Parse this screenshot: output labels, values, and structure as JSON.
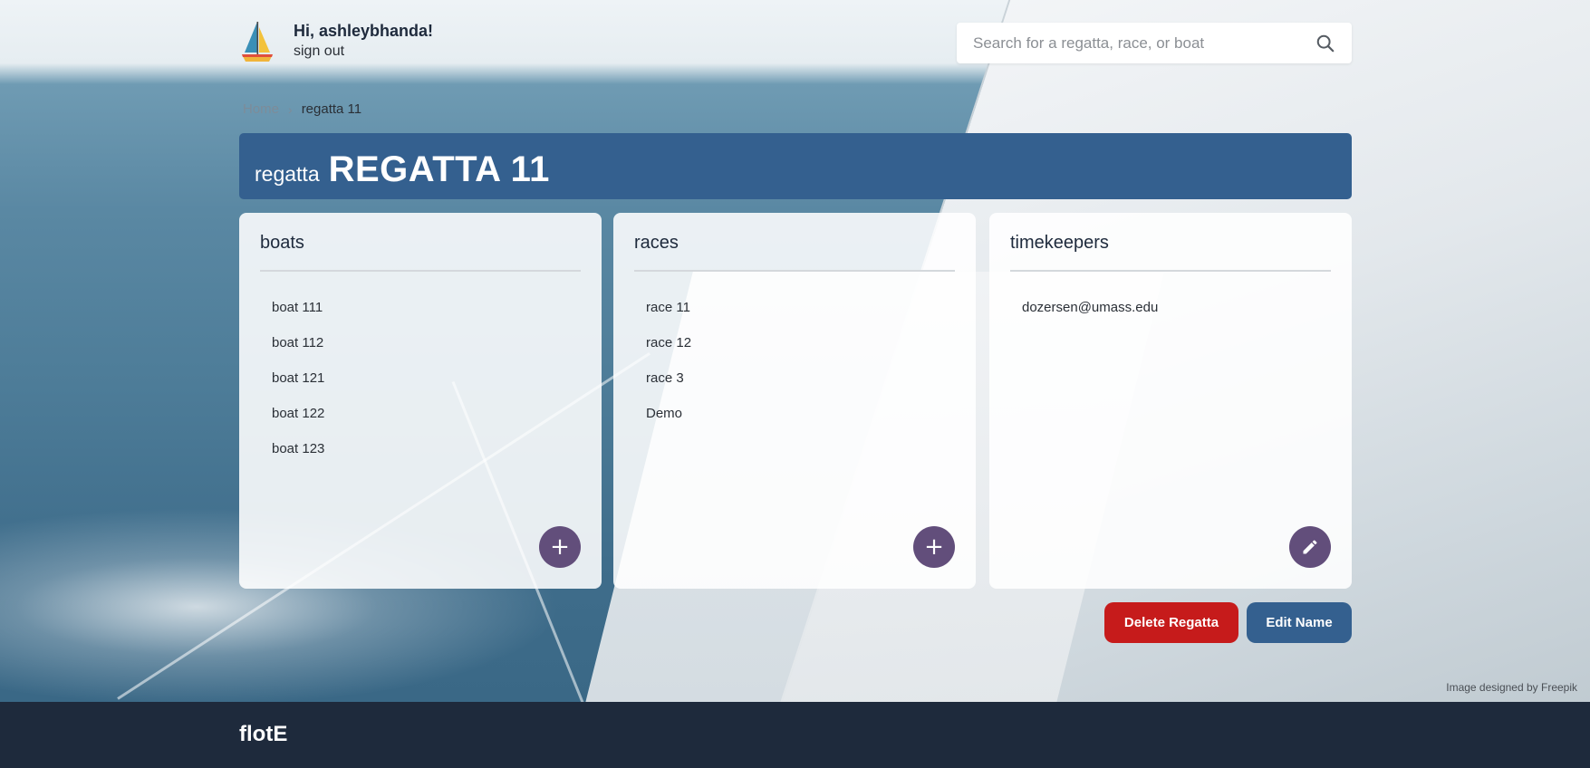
{
  "header": {
    "greeting": "Hi, ashleybhanda!",
    "sign_out": "sign out",
    "search_placeholder": "Search for a regatta, race, or boat",
    "search_value": ""
  },
  "breadcrumb": {
    "home": "Home",
    "separator": "›",
    "current": "regatta 11"
  },
  "banner": {
    "kind": "regatta",
    "name": "REGATTA 11"
  },
  "cards": {
    "boats": {
      "title": "boats",
      "items": [
        "boat 111",
        "boat 112",
        "boat 121",
        "boat 122",
        "boat 123"
      ],
      "action": "+"
    },
    "races": {
      "title": "races",
      "items": [
        "race 11",
        "race 12",
        "race 3",
        "Demo"
      ],
      "action": "+"
    },
    "timekeepers": {
      "title": "timekeepers",
      "items": [
        "dozersen@umass.edu"
      ],
      "action": "edit-icon"
    }
  },
  "actions": {
    "delete": "Delete Regatta",
    "edit_name": "Edit Name"
  },
  "credit": "Image designed by Freepik",
  "footer": {
    "brand": "flotE"
  },
  "colors": {
    "primary": "#34608f",
    "danger": "#c61b1b",
    "fab": "#624e7b",
    "footer": "#1e2a3c"
  }
}
